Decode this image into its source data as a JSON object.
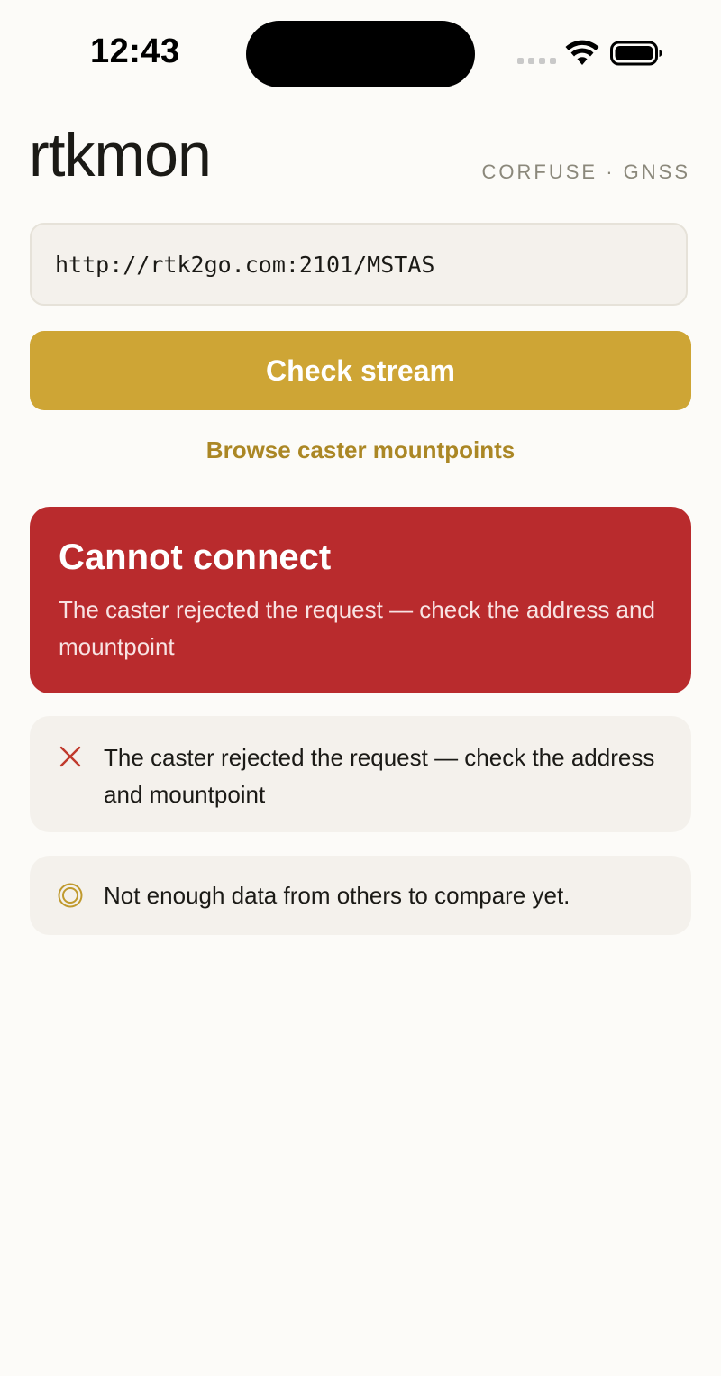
{
  "status_bar": {
    "time": "12:43"
  },
  "header": {
    "title": "rtkmon",
    "subtitle": "CORFUSE · GNSS"
  },
  "stream_form": {
    "url_value": "http://rtk2go.com:2101/MSTAS",
    "check_button_label": "Check stream",
    "browse_link_label": "Browse caster mountpoints"
  },
  "error_banner": {
    "title": "Cannot connect",
    "message": "The caster rejected the request — check the address and mountpoint"
  },
  "results": [
    {
      "icon": "close-icon",
      "text": "The caster rejected the request — check the address and mountpoint"
    },
    {
      "icon": "target-icon",
      "text": "Not enough data from others to compare yet."
    }
  ],
  "colors": {
    "accent": "#cea535",
    "accent_text": "#ab8725",
    "error": "#b92b2d",
    "card_background": "#f4f1ec",
    "page_background": "#fcfbf8"
  }
}
